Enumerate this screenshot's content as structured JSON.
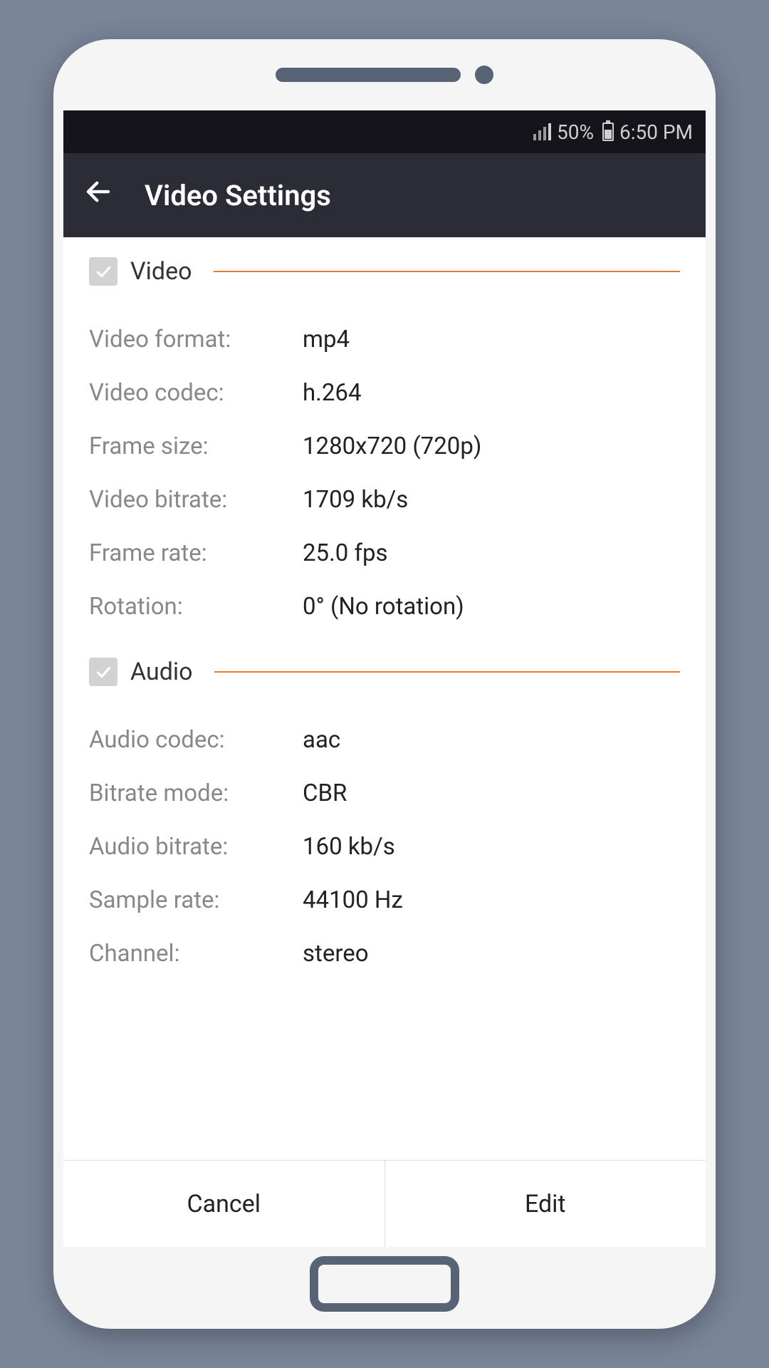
{
  "status_bar": {
    "battery_text": "50%",
    "time": "6:50 PM"
  },
  "app_bar": {
    "title": "Video Settings"
  },
  "sections": {
    "video": {
      "title": "Video",
      "rows": [
        {
          "label": "Video format:",
          "value": "mp4"
        },
        {
          "label": "Video codec:",
          "value": "h.264"
        },
        {
          "label": "Frame size:",
          "value": "1280x720 (720p)"
        },
        {
          "label": "Video bitrate:",
          "value": "1709 kb/s"
        },
        {
          "label": "Frame rate:",
          "value": "25.0 fps"
        },
        {
          "label": "Rotation:",
          "value": "0° (No rotation)"
        }
      ]
    },
    "audio": {
      "title": "Audio",
      "rows": [
        {
          "label": "Audio codec:",
          "value": "aac"
        },
        {
          "label": "Bitrate mode:",
          "value": "CBR"
        },
        {
          "label": "Audio bitrate:",
          "value": "160 kb/s"
        },
        {
          "label": "Sample rate:",
          "value": "44100 Hz"
        },
        {
          "label": "Channel:",
          "value": "stereo"
        }
      ]
    }
  },
  "bottom_bar": {
    "cancel": "Cancel",
    "edit": "Edit"
  }
}
